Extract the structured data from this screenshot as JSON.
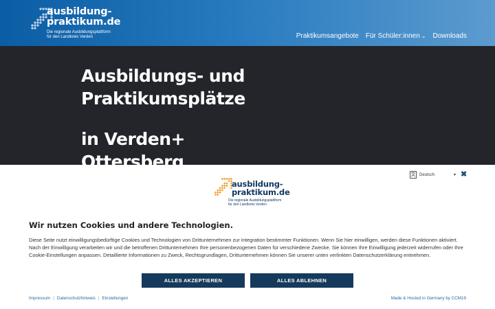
{
  "header": {
    "logo_line1": "ausbildung-",
    "logo_line2": "praktikum.de",
    "logo_sub1": "Die regionale Ausbildungsplattform",
    "logo_sub2": "für den Landkreis Verden",
    "nav": [
      {
        "label": "Praktikumsangebote"
      },
      {
        "label": "Für Schüler:innen"
      },
      {
        "label": "Downloads"
      }
    ]
  },
  "hero": {
    "line1": "Ausbildungs- und",
    "line2": "Praktikumsplätze",
    "line3": "in Verden+",
    "line4": "Ottersberg"
  },
  "banner": {
    "language": "Deutsch",
    "logo_line1": "ausbildung-",
    "logo_line2": "praktikum.de",
    "logo_sub1": "Die regionale Ausbildungsplattform",
    "logo_sub2": "für den Landkreis Verden",
    "title": "Wir nutzen Cookies und andere Technologien.",
    "text": "Diese Seite nutzt einwilligungsbedürftige Cookies und Technologien von Drittunternehmen zur Integration bestimmter Funktionen. Wenn Sie hier einwilligen, werden diese Funktionen aktiviert. Nach der Einwilligung verarbeiten wir und die betroffenen Drittunternehmen Ihre personenbezogenen Daten für verschiedene Zwecke. Sie können Ihre Einwilligung jederzeit widerrufen oder Ihre Cookie-Einstellungen anpassen. Detaillierte Informationen zu Zweck, Rechtsgrundlagen, Drittunternehmen können Sie unserer unten verlinkten Datenschutzerklärung entnehmen.",
    "accept_label": "ALLES AKZEPTIEREN",
    "reject_label": "ALLES ABLEHNEN",
    "footer_links": [
      {
        "label": "Impressum"
      },
      {
        "label": "Datenschutzhinweis"
      },
      {
        "label": "Einstellungen"
      }
    ],
    "made_by": "Made & Hosted in Germany by CCM19"
  },
  "colors": {
    "header_start": "#0b5da4",
    "header_end": "#5c9bcf",
    "hero_bg": "#23252b",
    "button_bg": "#153a5b",
    "link": "#2b6aa3",
    "arrow_orange": "#f39a2d"
  }
}
